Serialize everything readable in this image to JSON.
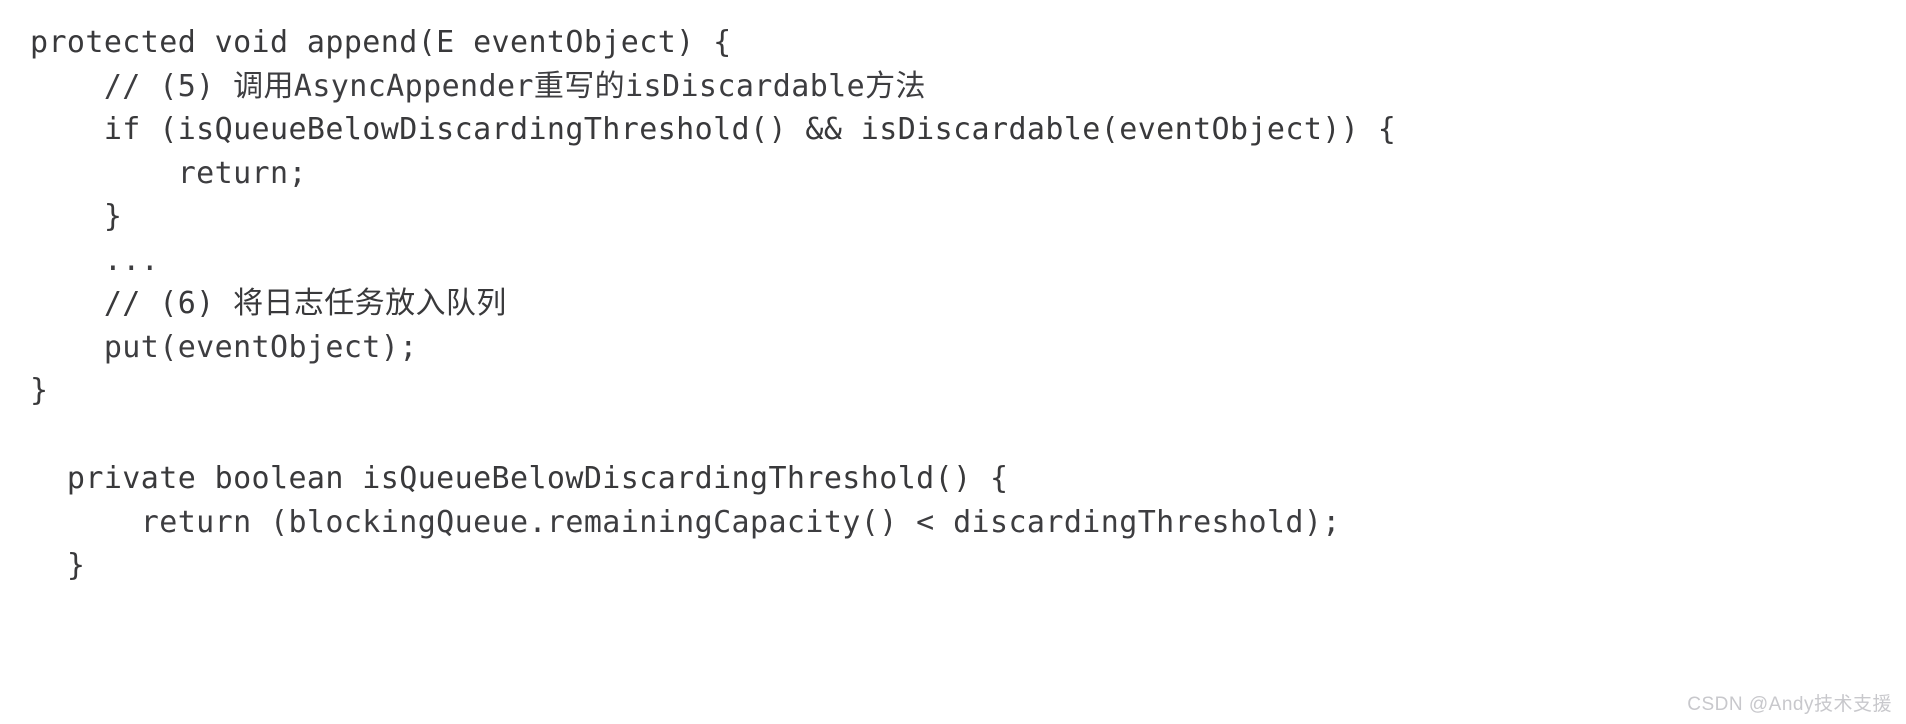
{
  "page": {
    "background_color": "#ffffff",
    "text_color": "#3a3a3c",
    "language": "java"
  },
  "code_blocks": [
    {
      "id": "append-method",
      "lines": [
        "protected void append(E eventObject) {",
        "    // (5) 调用AsyncAppender重写的isDiscardable方法",
        "    if (isQueueBelowDiscardingThreshold() && isDiscardable(eventObject)) {",
        "        return;",
        "    }",
        "    ...",
        "    // (6) 将日志任务放入队列",
        "    put(eventObject);",
        "}"
      ]
    },
    {
      "id": "is-queue-below-discarding-threshold-method",
      "lines": [
        "  private boolean isQueueBelowDiscardingThreshold() {",
        "      return (blockingQueue.remainingCapacity() < discardingThreshold);",
        "  }"
      ]
    }
  ],
  "watermark": {
    "text": "CSDN @Andy技术支援",
    "color": "#c8c8cc"
  }
}
